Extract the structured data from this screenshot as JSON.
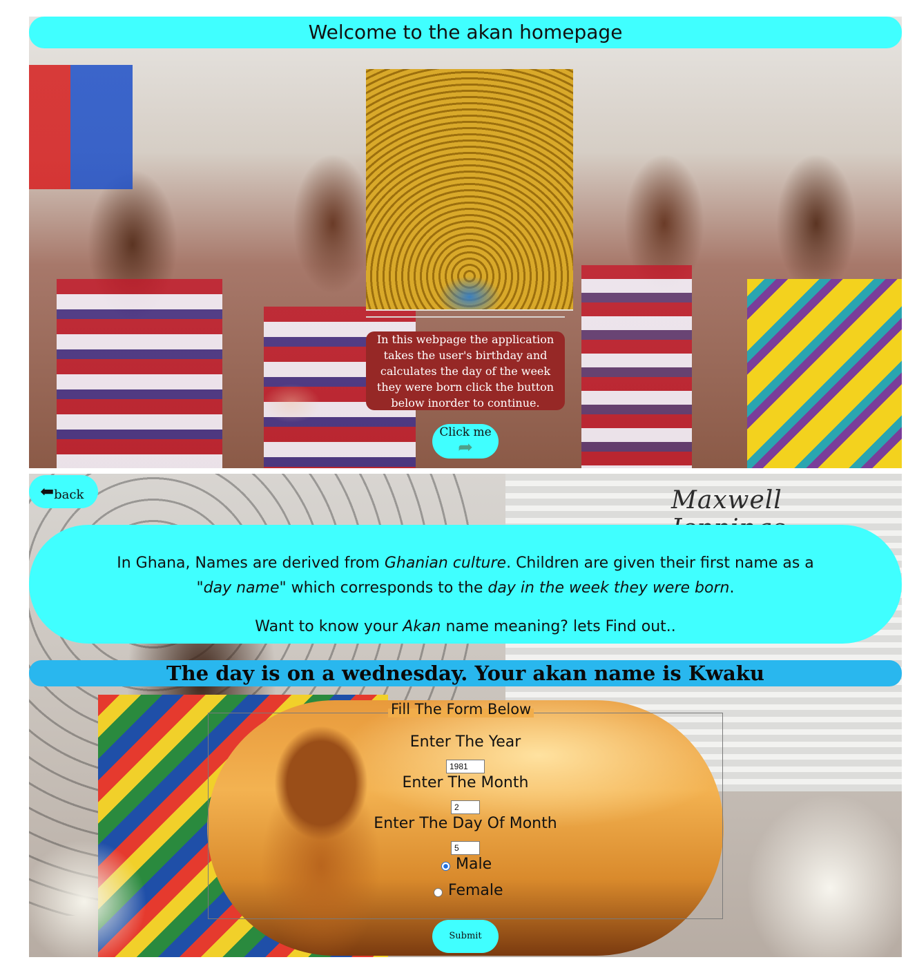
{
  "header": {
    "welcome_title": "Welcome to the akan homepage"
  },
  "hero": {
    "portrait_alt": "",
    "info_text": "In this webpage the application takes the user's birthday and calculates the day of the week they were born click the button below inorder to continue.",
    "click_me_label": "Click me",
    "click_me_icon": "share-arrow-icon"
  },
  "second_section": {
    "back_label": "back",
    "back_icon": "reply-arrow-icon",
    "signature": "Maxwell Jennings",
    "intro": {
      "part1": "In Ghana, Names are derived from ",
      "em1": "Ghanian culture",
      "part2": ". Children are given their first name as a",
      "em2": "\"day name\"",
      "part3": " which corresponds to the ",
      "em3": "day in the week they were born",
      "part4": ".",
      "question_part1": "Want to know your ",
      "question_em": "Akan",
      "question_part2": " name meaning? lets Find out.."
    },
    "result_text": "The day is on a wednesday. Your akan name is Kwaku",
    "form": {
      "legend": "Fill The Form Below",
      "year_label": "Enter The Year",
      "year_value": "1981",
      "month_label": "Enter The Month",
      "month_value": "2",
      "day_label": "Enter The Day Of Month",
      "day_value": "5",
      "male_label": "Male",
      "female_label": "Female",
      "selected_gender": "Male",
      "submit_label": "Submit"
    }
  },
  "colors": {
    "cyan_banner": "#40ffff",
    "result_banner": "#29b7ee",
    "info_box": "#962826"
  }
}
